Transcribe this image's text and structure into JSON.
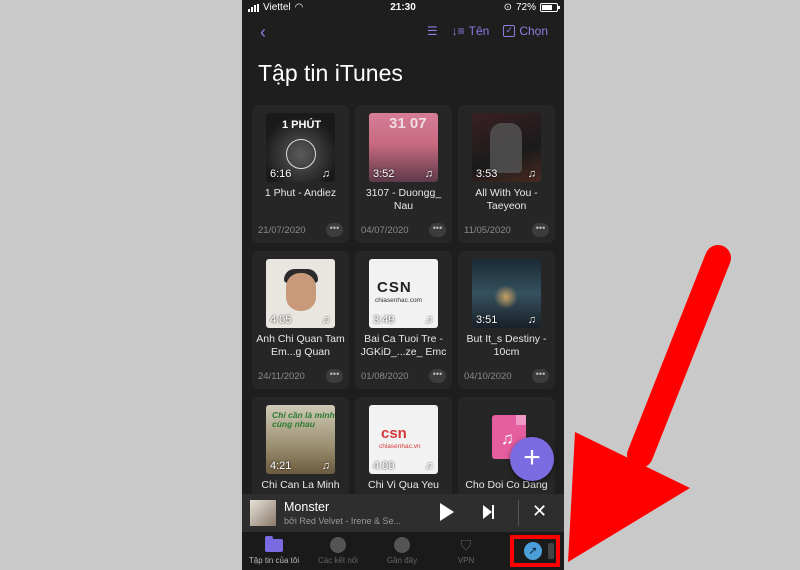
{
  "status_bar": {
    "carrier": "Viettel",
    "time": "21:30",
    "battery": "72%",
    "battery_level": 0.72
  },
  "nav": {
    "back_icon": "chevron-left-icon",
    "sort_label": "Tên",
    "select_label": "Chọn"
  },
  "page_title": "Tập tin iTunes",
  "files": [
    {
      "duration": "6:16",
      "title": "1 Phut - Andiez",
      "date": "21/07/2020",
      "thumb_text": "1 PHÚT"
    },
    {
      "duration": "3:52",
      "title": "3107 - Duongg_ Nau",
      "date": "04/07/2020",
      "thumb_text": "31 07"
    },
    {
      "duration": "3:53",
      "title": "All With You - Taeyeon",
      "date": "11/05/2020"
    },
    {
      "duration": "4:05",
      "title": "Anh Chi Quan Tam Em...g Quan",
      "date": "24/11/2020"
    },
    {
      "duration": "3:49",
      "title": "Bai Ca Tuoi Tre - JGKiD_...ze_ Emc",
      "date": "01/08/2020",
      "thumb_text": "CSN",
      "thumb_sub": "chiasenhac.com"
    },
    {
      "duration": "3:51",
      "title": "But It_s Destiny - 10cm",
      "date": "04/10/2020"
    },
    {
      "duration": "4:21",
      "title": "Chi Can La Minh",
      "date": "",
      "thumb_text": "Chỉ cần là mình cùng nhau"
    },
    {
      "duration": "4:00",
      "title": "Chi Vi Qua Yeu",
      "date": "",
      "thumb_text": "csn",
      "thumb_sub": "chiasenhac.vn"
    },
    {
      "duration": "",
      "title": "Cho Doi Co Dang",
      "date": ""
    }
  ],
  "player": {
    "title": "Monster",
    "subtitle": "bởi Red Velvet - Irene & Se..."
  },
  "tabs": [
    {
      "label": "Tập tin của tôi",
      "icon": "folder-icon"
    },
    {
      "label": "Các kết nối",
      "icon": "wifi-icon"
    },
    {
      "label": "Gần đây",
      "icon": "clock-icon"
    },
    {
      "label": "VPN",
      "icon": "shield-bolt-icon"
    }
  ],
  "colors": {
    "accent": "#7b6be0",
    "highlight": "#ff0000"
  }
}
